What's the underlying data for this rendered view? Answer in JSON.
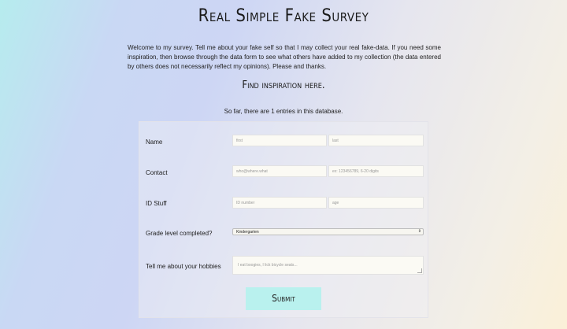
{
  "page": {
    "title": "Real Simple Fake Survey",
    "intro": "Welcome to my survey. Tell me about your fake self so that I may collect your real fake-data. If you need some inspiration, then browse through the data form to see what others have added to my collection (the data entered by others does not necessarily reflect my opinions). Please and thanks.",
    "inspiration_link": "Find inspiration here.",
    "entry_count_text": "So far, there are 1 entries in this database."
  },
  "form": {
    "name": {
      "label": "Name",
      "first_placeholder": "first",
      "last_placeholder": "last"
    },
    "contact": {
      "label": "Contact",
      "email_placeholder": "who@where.what",
      "phone_placeholder": "ex: 123456789, 6-20 digits"
    },
    "id": {
      "label": "ID Stuff",
      "id_placeholder": "ID number",
      "age_placeholder": "age"
    },
    "grade": {
      "label": "Grade level completed?",
      "selected": "Kindergarten"
    },
    "hobbies": {
      "label": "Tell me about your hobbies",
      "placeholder": "I eat boogies, I lick bicycle seats..."
    },
    "submit_label": "Submit"
  }
}
